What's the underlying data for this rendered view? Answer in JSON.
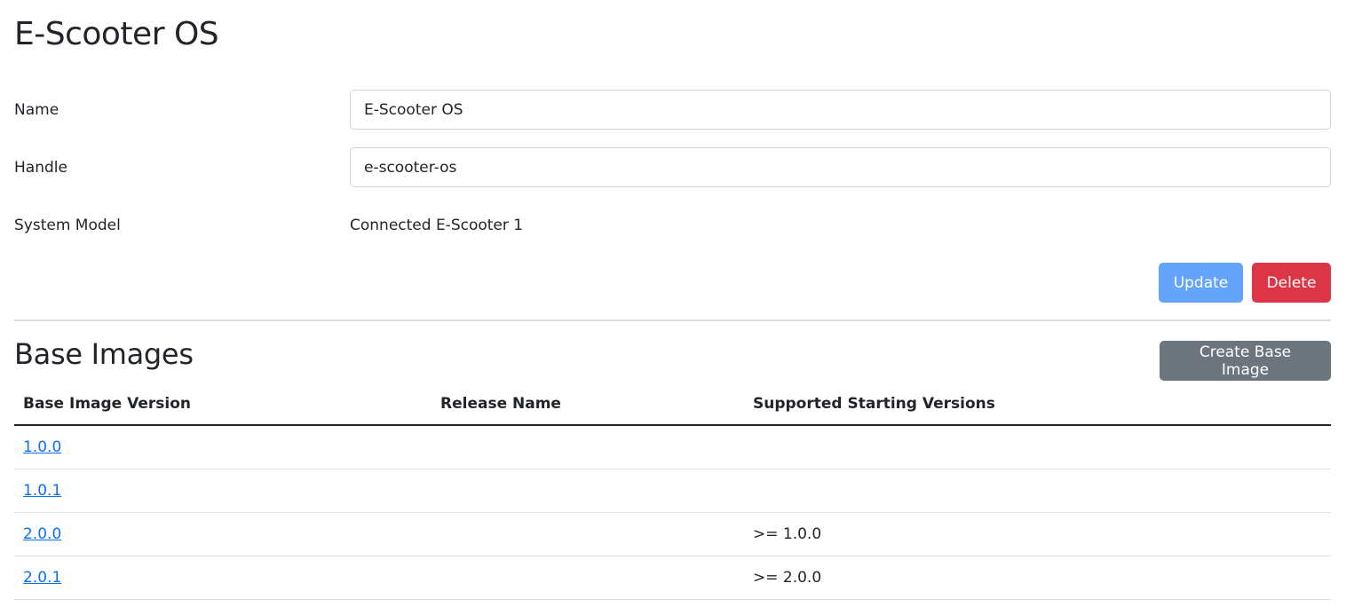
{
  "page": {
    "title": "E-Scooter OS"
  },
  "form": {
    "name": {
      "label": "Name",
      "value": "E-Scooter OS"
    },
    "handle": {
      "label": "Handle",
      "value": "e-scooter-os"
    },
    "system_model": {
      "label": "System Model",
      "value": "Connected E-Scooter 1"
    },
    "update_label": "Update",
    "delete_label": "Delete"
  },
  "base_images": {
    "title": "Base Images",
    "create_label": "Create Base Image",
    "columns": [
      "Base Image Version",
      "Release Name",
      "Supported Starting Versions"
    ],
    "rows": [
      {
        "version": "1.0.0",
        "release_name": "",
        "supported": ""
      },
      {
        "version": "1.0.1",
        "release_name": "",
        "supported": ""
      },
      {
        "version": "2.0.0",
        "release_name": "",
        "supported": ">= 1.0.0"
      },
      {
        "version": "2.0.1",
        "release_name": "",
        "supported": ">= 2.0.0"
      }
    ]
  },
  "colors": {
    "primary_light": "#64a4fb",
    "danger": "#dc3545",
    "secondary": "#6c757d",
    "link": "#0d6efd"
  }
}
